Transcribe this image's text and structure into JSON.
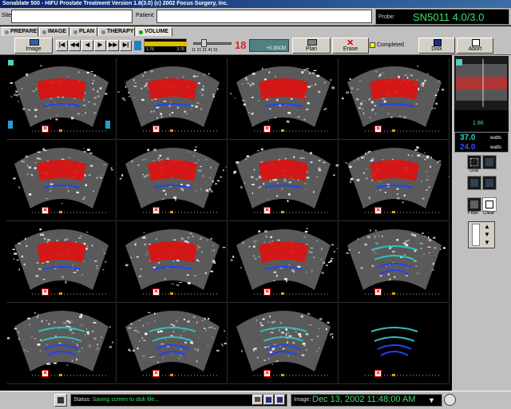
{
  "window": {
    "title": "Sonablate 500 - HIFU Prostate Treatment  Version 1.8(3.0)   (c) 2002 Focus Surgery, Inc."
  },
  "header": {
    "site_label": "Site:",
    "patient_label": "Patient:",
    "probe_label": "Probe:",
    "probe_value": "SN5011  4.0/3.0"
  },
  "tabs": [
    {
      "label": "PREPARE",
      "active": false
    },
    {
      "label": "IMAGE",
      "active": false
    },
    {
      "label": "PLAN",
      "active": false
    },
    {
      "label": "THERAPY",
      "active": false
    },
    {
      "label": "VOLUME",
      "active": true
    }
  ],
  "toolbar": {
    "image_label": "Image",
    "playback": [
      "first",
      "rewind",
      "step-back",
      "play",
      "fast-forward",
      "last"
    ],
    "playback_glyphs": [
      "|◀",
      "◀◀",
      "◀",
      "▶",
      "▶▶",
      "▶|"
    ],
    "ruler_ticks": [
      "1.76",
      "3.76"
    ],
    "slider_ticks": "11   21   31   41   51",
    "slice_number": "18",
    "offset": "+0.30CM",
    "plan_label": "Plan",
    "erase_label": "Erase",
    "completed_label": "Completed",
    "disk_label": "Disk",
    "abort_label": "Abort"
  },
  "side": {
    "zoom": "1.86",
    "watts_1": "37.0",
    "watts_2": "24.0",
    "watts_unit": "watts",
    "grid_label": "Grid",
    "filter_label": "Filter",
    "clear_label": "Clear"
  },
  "status": {
    "label": "Status:",
    "text": "Saving screen to disk file...",
    "image_label": "Image:",
    "image_date": "Dec 13, 2002  11:48:00 AM"
  },
  "colors": {
    "treatment_zone": "#e01010",
    "blue_arc": "#2040ff",
    "cyan_arc": "#30c0c0",
    "status_green": "#3ce06a"
  },
  "cells": [
    {
      "treat": true
    },
    {
      "treat": true
    },
    {
      "treat": true
    },
    {
      "treat": true
    },
    {
      "treat": true
    },
    {
      "treat": true
    },
    {
      "treat": true
    },
    {
      "treat": true
    },
    {
      "treat": true
    },
    {
      "treat": true
    },
    {
      "treat": true
    },
    {
      "treat": false
    },
    {
      "treat": false
    },
    {
      "treat": false
    },
    {
      "treat": false
    },
    {
      "treat": false
    }
  ]
}
